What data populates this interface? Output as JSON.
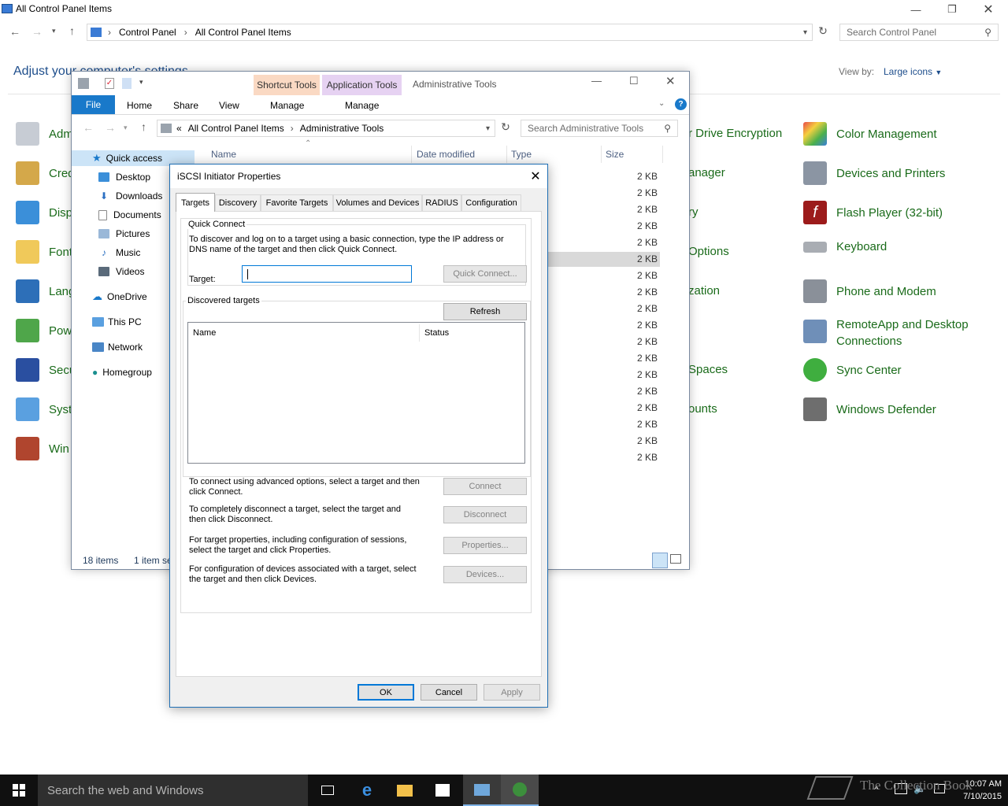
{
  "control_panel": {
    "window_title": "All Control Panel Items",
    "breadcrumb": [
      "Control Panel",
      "All Control Panel Items"
    ],
    "search_placeholder": "Search Control Panel",
    "heading": "Adjust your computer's settings",
    "view_by_label": "View by:",
    "view_by_value": "Large icons",
    "left_items": [
      "Adm",
      "Cred",
      "Disp",
      "Font",
      "Lang",
      "Pow",
      "Secu",
      "Syst",
      "Win"
    ],
    "mid_items": [
      "r Drive Encryption",
      "anager",
      "ry",
      "Options",
      "zation",
      "Spaces",
      "ounts"
    ],
    "right_items": [
      "Color Management",
      "Devices and Printers",
      "Flash Player (32-bit)",
      "Keyboard",
      "Phone and Modem",
      "RemoteApp and Desktop Connections",
      "Sync Center",
      "Windows Defender"
    ]
  },
  "explorer": {
    "title": "Administrative Tools",
    "ribbon": {
      "file": "File",
      "tabs": [
        "Home",
        "Share",
        "View"
      ],
      "context_shortcut": "Shortcut Tools",
      "context_app": "Application Tools",
      "manage": "Manage"
    },
    "address": {
      "prefix": "«",
      "parts": [
        "All Control Panel Items",
        "Administrative Tools"
      ]
    },
    "search_placeholder": "Search Administrative Tools",
    "columns": [
      "Name",
      "Date modified",
      "Type",
      "Size"
    ],
    "nav": {
      "quick_access": "Quick access",
      "items": [
        "Desktop",
        "Downloads",
        "Documents",
        "Pictures",
        "Music",
        "Videos"
      ],
      "onedrive": "OneDrive",
      "this_pc": "This PC",
      "network": "Network",
      "homegroup": "Homegroup"
    },
    "sizes": [
      "2 KB",
      "2 KB",
      "2 KB",
      "2 KB",
      "2 KB",
      "2 KB",
      "2 KB",
      "2 KB",
      "2 KB",
      "2 KB",
      "2 KB",
      "2 KB",
      "2 KB",
      "2 KB",
      "2 KB",
      "2 KB",
      "2 KB",
      "2 KB"
    ],
    "status_count": "18 items",
    "status_selected": "1 item se"
  },
  "dialog": {
    "title": "iSCSI Initiator Properties",
    "tabs": [
      "Targets",
      "Discovery",
      "Favorite Targets",
      "Volumes and Devices",
      "RADIUS",
      "Configuration"
    ],
    "quick_connect_label": "Quick Connect",
    "quick_connect_text": "To discover and log on to a target using a basic connection, type the IP address or DNS name of the target and then click Quick Connect.",
    "target_label": "Target:",
    "target_value": "",
    "quick_connect_button": "Quick Connect...",
    "discovered_label": "Discovered targets",
    "refresh_button": "Refresh",
    "list_columns": [
      "Name",
      "Status"
    ],
    "connect_text": "To connect using advanced options, select a target and then click Connect.",
    "connect_button": "Connect",
    "disconnect_text": "To completely disconnect a target, select the target and then click Disconnect.",
    "disconnect_button": "Disconnect",
    "properties_text": "For target properties, including configuration of sessions, select the target and click Properties.",
    "properties_button": "Properties...",
    "devices_text": "For configuration of devices associated with a target, select the target and then click Devices.",
    "devices_button": "Devices...",
    "ok": "OK",
    "cancel": "Cancel",
    "apply": "Apply"
  },
  "taskbar": {
    "search_placeholder": "Search the web and Windows",
    "time": "10:07 AM",
    "date": "7/10/2015",
    "watermark": "The Collection Book"
  }
}
